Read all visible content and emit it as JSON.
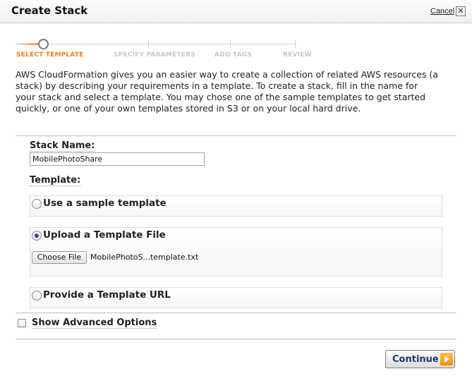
{
  "dialog": {
    "title": "Create Stack",
    "cancel_label": "Cancel",
    "close_symbol": "✕"
  },
  "steps": [
    {
      "label": "SELECT TEMPLATE",
      "active": true
    },
    {
      "label": "SPECIFY PARAMETERS",
      "active": false
    },
    {
      "label": "ADD TAGS",
      "active": false
    },
    {
      "label": "REVIEW",
      "active": false
    }
  ],
  "description": "AWS CloudFormation gives you an easier way to create a collection of related AWS resources (a stack) by describing your requirements in a template. To create a stack, fill in the name for your stack and select a template. You may chose one of the sample templates to get started quickly, or one of your own templates stored in S3 or on your local hard drive.",
  "form": {
    "stack_name_label": "Stack Name:",
    "stack_name_value": "MobilePhotoShare",
    "template_label": "Template:",
    "options": [
      {
        "label": "Use a sample template",
        "selected": false
      },
      {
        "label": "Upload a Template File",
        "selected": true
      },
      {
        "label": "Provide a Template URL",
        "selected": false
      }
    ],
    "choose_file_label": "Choose File",
    "file_name": "MobilePhotoS...template.txt",
    "advanced_label": "Show Advanced Options",
    "advanced_checked": false
  },
  "footer": {
    "continue_label": "Continue"
  },
  "colors": {
    "accent": "#e8821c",
    "button_text": "#1b3a6b"
  }
}
